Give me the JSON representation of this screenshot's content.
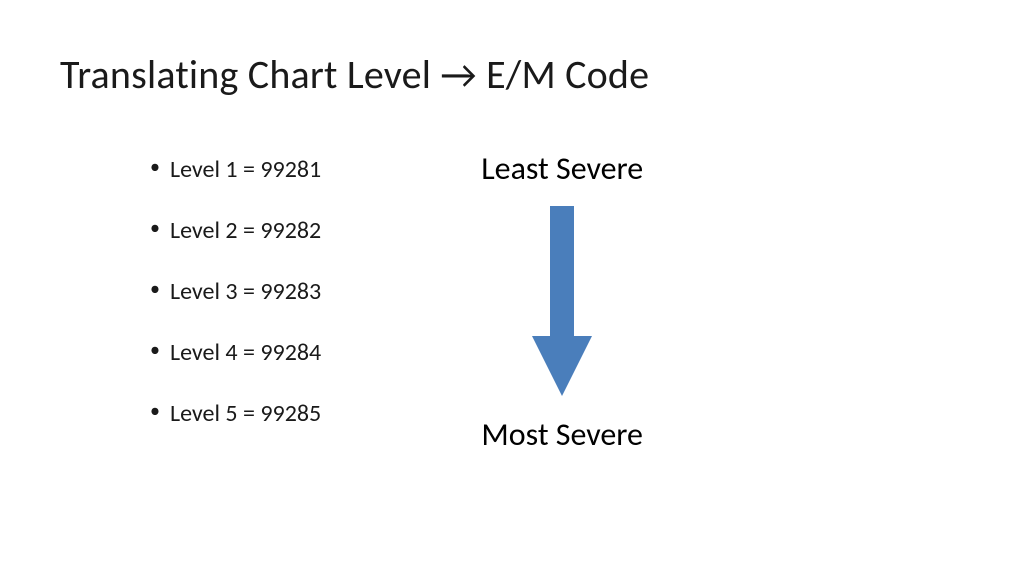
{
  "title_pre": "Translating Chart Level ",
  "title_post": " E/M Code",
  "levels": [
    "Level 1 = 99281",
    "Level 2 = 99282",
    "Level 3 = 99283",
    "Level 4 = 99284",
    "Level 5 = 99285"
  ],
  "severity_top": "Least Severe",
  "severity_bottom": "Most Severe",
  "arrow_color": "#4A7EBB"
}
